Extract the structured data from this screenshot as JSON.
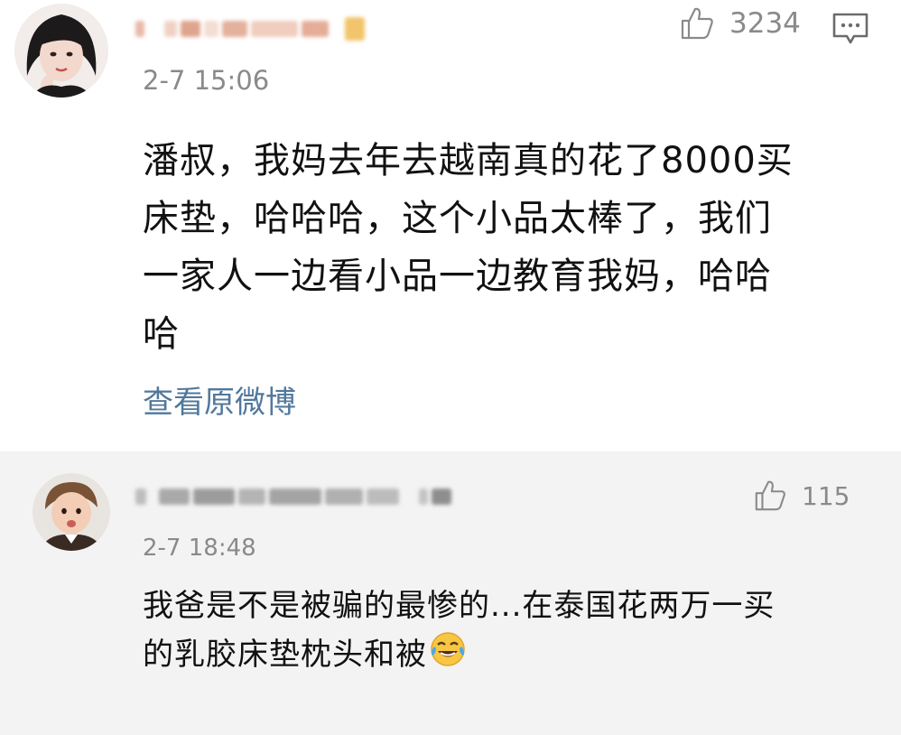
{
  "comments": [
    {
      "time": "2-7 15:06",
      "likes": "3234",
      "text_lines": [
        "潘叔，我妈去年去越南真的花了8000买",
        "床垫，哈哈哈，这个小品太棒了，我们",
        "一家人一边看小品一边教育我妈，哈哈",
        "哈"
      ],
      "view_original": "查看原微博",
      "icons": {
        "like": "thumbs-up-icon",
        "reply": "comment-bubble-icon"
      }
    },
    {
      "time": "2-7 18:48",
      "likes": "115",
      "text_lines": [
        "我爸是不是被骗的最惨的...在泰国花两万一买",
        "的乳胶床垫枕头和被"
      ],
      "emoji": "crying-laughing-emoji",
      "icons": {
        "like": "thumbs-up-icon"
      }
    }
  ],
  "colors": {
    "link": "#51789b",
    "meta_gray": "#8a8a8a",
    "second_bg": "#f3f3f3"
  }
}
